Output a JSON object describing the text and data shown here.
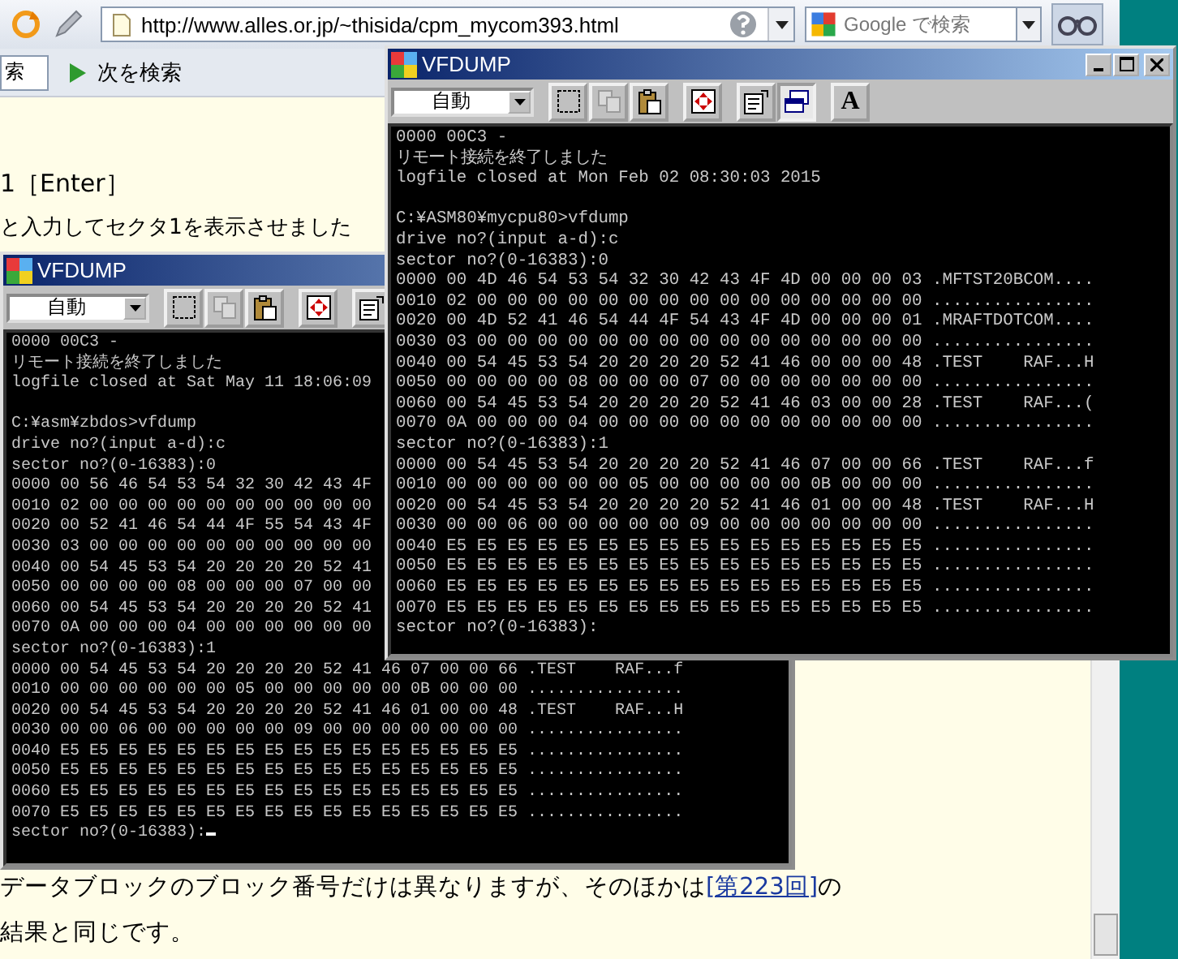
{
  "browser": {
    "url": "http://www.alles.or.jp/~thisida/cpm_mycom393.html",
    "search": {
      "placeholder": "Google で検索"
    },
    "find": {
      "value": "索"
    },
    "find_next": {
      "label": "次を検索"
    }
  },
  "page": {
    "lines": [
      "1［Enter］",
      "と入力してセクタ1を表示させました"
    ],
    "paragraph": {
      "before": "データブロックのブロック番号だけは異なりますが、そのほかは",
      "link": "[第223回]",
      "after": "の結果と同じです。"
    }
  },
  "windows": [
    {
      "title": "VFDUMP",
      "mode": "自動",
      "cursor": true,
      "tools": [
        {
          "kind": "select",
          "disabled": false,
          "pressed": false
        },
        {
          "kind": "copy",
          "disabled": true,
          "pressed": false
        },
        {
          "kind": "paste",
          "disabled": false,
          "pressed": false
        },
        {
          "kind": "move",
          "disabled": false,
          "pressed": false
        },
        {
          "kind": "properties",
          "disabled": false,
          "pressed": false
        }
      ],
      "blocks": [
        [
          "0000 00C3 -",
          "リモート接続を終了しました",
          "logfile closed at Sat May 11 18:06:09"
        ],
        [
          "C:¥asm¥zbdos>vfdump",
          "drive no?(input a-d):c",
          "sector no?(0-16383):0",
          "0000 00 56 46 54 53 54 32 30 42 43 4F",
          "0010 02 00 00 00 00 00 00 00 00 00 00",
          "0020 00 52 41 46 54 44 4F 55 54 43 4F",
          "0030 03 00 00 00 00 00 00 00 00 00 00",
          "0040 00 54 45 53 54 20 20 20 20 52 41",
          "0050 00 00 00 00 08 00 00 00 07 00 00",
          "0060 00 54 45 53 54 20 20 20 20 52 41",
          "0070 0A 00 00 00 04 00 00 00 00 00 00",
          "sector no?(0-16383):1",
          "0000 00 54 45 53 54 20 20 20 20 52 41 46 07 00 00 66 .TEST    RAF...f",
          "0010 00 00 00 00 00 00 05 00 00 00 00 00 0B 00 00 00 ................",
          "0020 00 54 45 53 54 20 20 20 20 52 41 46 01 00 00 48 .TEST    RAF...H",
          "0030 00 00 06 00 00 00 00 00 09 00 00 00 00 00 00 00 ................",
          "0040 E5 E5 E5 E5 E5 E5 E5 E5 E5 E5 E5 E5 E5 E5 E5 E5 ................",
          "0050 E5 E5 E5 E5 E5 E5 E5 E5 E5 E5 E5 E5 E5 E5 E5 E5 ................",
          "0060 E5 E5 E5 E5 E5 E5 E5 E5 E5 E5 E5 E5 E5 E5 E5 E5 ................",
          "0070 E5 E5 E5 E5 E5 E5 E5 E5 E5 E5 E5 E5 E5 E5 E5 E5 ................",
          "sector no?(0-16383):"
        ]
      ]
    },
    {
      "title": "VFDUMP",
      "mode": "自動",
      "controls": [
        {
          "kind": "minimize"
        },
        {
          "kind": "maximize"
        },
        {
          "kind": "close"
        }
      ],
      "cursor": false,
      "tools": [
        {
          "kind": "select",
          "disabled": false,
          "pressed": false
        },
        {
          "kind": "copy",
          "disabled": true,
          "pressed": false
        },
        {
          "kind": "paste",
          "disabled": false,
          "pressed": false
        },
        {
          "kind": "move",
          "disabled": false,
          "pressed": false
        },
        {
          "kind": "properties",
          "disabled": false,
          "pressed": false
        },
        {
          "kind": "background",
          "disabled": false,
          "pressed": true
        },
        {
          "kind": "font",
          "label": "A",
          "disabled": false,
          "pressed": false
        }
      ],
      "blocks": [
        [
          "0000 00C3 -",
          "リモート接続を終了しました",
          "logfile closed at Mon Feb 02 08:30:03 2015"
        ],
        [
          "C:¥ASM80¥mycpu80>vfdump",
          "drive no?(input a-d):c",
          "sector no?(0-16383):0",
          "0000 00 4D 46 54 53 54 32 30 42 43 4F 4D 00 00 00 03 .MFTST20BCOM....",
          "0010 02 00 00 00 00 00 00 00 00 00 00 00 00 00 00 00 ................",
          "0020 00 4D 52 41 46 54 44 4F 54 43 4F 4D 00 00 00 01 .MRAFTDOTCOM....",
          "0030 03 00 00 00 00 00 00 00 00 00 00 00 00 00 00 00 ................",
          "0040 00 54 45 53 54 20 20 20 20 52 41 46 00 00 00 48 .TEST    RAF...H",
          "0050 00 00 00 00 08 00 00 00 07 00 00 00 00 00 00 00 ................",
          "0060 00 54 45 53 54 20 20 20 20 52 41 46 03 00 00 28 .TEST    RAF...(",
          "0070 0A 00 00 00 04 00 00 00 00 00 00 00 00 00 00 00 ................",
          "sector no?(0-16383):1",
          "0000 00 54 45 53 54 20 20 20 20 52 41 46 07 00 00 66 .TEST    RAF...f",
          "0010 00 00 00 00 00 00 05 00 00 00 00 00 0B 00 00 00 ................",
          "0020 00 54 45 53 54 20 20 20 20 52 41 46 01 00 00 48 .TEST    RAF...H",
          "0030 00 00 06 00 00 00 00 00 09 00 00 00 00 00 00 00 ................",
          "0040 E5 E5 E5 E5 E5 E5 E5 E5 E5 E5 E5 E5 E5 E5 E5 E5 ................",
          "0050 E5 E5 E5 E5 E5 E5 E5 E5 E5 E5 E5 E5 E5 E5 E5 E5 ................",
          "0060 E5 E5 E5 E5 E5 E5 E5 E5 E5 E5 E5 E5 E5 E5 E5 E5 ................",
          "0070 E5 E5 E5 E5 E5 E5 E5 E5 E5 E5 E5 E5 E5 E5 E5 E5 ................",
          "sector no?(0-16383):"
        ]
      ]
    }
  ]
}
